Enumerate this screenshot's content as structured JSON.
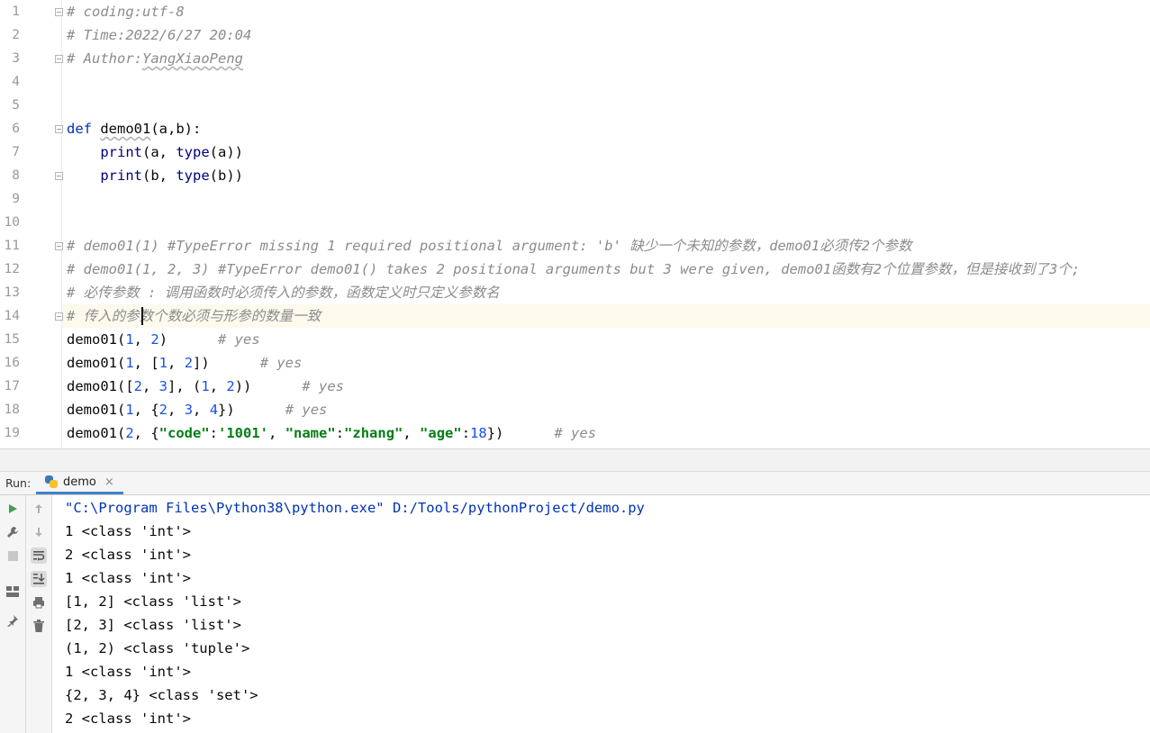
{
  "editor": {
    "line_numbers": [
      "1",
      "2",
      "3",
      "4",
      "5",
      "6",
      "7",
      "8",
      "9",
      "10",
      "11",
      "12",
      "13",
      "14",
      "15",
      "16",
      "17",
      "18",
      "19"
    ],
    "lines": [
      [
        {
          "t": "# coding:utf-8",
          "c": "cmt"
        }
      ],
      [
        {
          "t": "# Time:2022/6/27 20:04",
          "c": "cmt"
        }
      ],
      [
        {
          "t": "# Author:",
          "c": "cmt"
        },
        {
          "t": "YangXiaoPeng",
          "c": "cmt sq"
        }
      ],
      [],
      [],
      [
        {
          "t": "def",
          "c": "kw"
        },
        {
          "t": " "
        },
        {
          "t": "demo01",
          "c": "sq"
        },
        {
          "t": "(a,b):"
        }
      ],
      [
        {
          "t": "    "
        },
        {
          "t": "print",
          "c": "bi"
        },
        {
          "t": "(a, "
        },
        {
          "t": "type",
          "c": "bi"
        },
        {
          "t": "(a))"
        }
      ],
      [
        {
          "t": "    "
        },
        {
          "t": "print",
          "c": "bi"
        },
        {
          "t": "(b, "
        },
        {
          "t": "type",
          "c": "bi"
        },
        {
          "t": "(b))"
        }
      ],
      [],
      [],
      [
        {
          "t": "# demo01(1) #TypeError missing 1 required positional argument: 'b' 缺少一个未知的参数，demo01必须传2个参数",
          "c": "cmt"
        }
      ],
      [
        {
          "t": "# demo01(1, 2, 3) #TypeError demo01() takes 2 positional arguments but 3 were given, demo01函数有2个位置参数，但是接收到了3个;",
          "c": "cmt"
        }
      ],
      [
        {
          "t": "# 必传参数 : 调用函数时必须传入的参数，函数定义时只定义参数名",
          "c": "cmt"
        }
      ],
      [
        {
          "t": "# 传入的参数个数必须与形参的数量一致",
          "c": "cmt"
        }
      ],
      [
        {
          "t": "demo01("
        },
        {
          "t": "1",
          "c": "num"
        },
        {
          "t": ", "
        },
        {
          "t": "2",
          "c": "num"
        },
        {
          "t": ")      "
        },
        {
          "t": "# yes",
          "c": "cmt"
        }
      ],
      [
        {
          "t": "demo01("
        },
        {
          "t": "1",
          "c": "num"
        },
        {
          "t": ", ["
        },
        {
          "t": "1",
          "c": "num"
        },
        {
          "t": ", "
        },
        {
          "t": "2",
          "c": "num"
        },
        {
          "t": "])      "
        },
        {
          "t": "# yes",
          "c": "cmt"
        }
      ],
      [
        {
          "t": "demo01(["
        },
        {
          "t": "2",
          "c": "num"
        },
        {
          "t": ", "
        },
        {
          "t": "3",
          "c": "num"
        },
        {
          "t": "], ("
        },
        {
          "t": "1",
          "c": "num"
        },
        {
          "t": ", "
        },
        {
          "t": "2",
          "c": "num"
        },
        {
          "t": "))      "
        },
        {
          "t": "# yes",
          "c": "cmt"
        }
      ],
      [
        {
          "t": "demo01("
        },
        {
          "t": "1",
          "c": "num"
        },
        {
          "t": ", {"
        },
        {
          "t": "2",
          "c": "num"
        },
        {
          "t": ", "
        },
        {
          "t": "3",
          "c": "num"
        },
        {
          "t": ", "
        },
        {
          "t": "4",
          "c": "num"
        },
        {
          "t": "})      "
        },
        {
          "t": "# yes",
          "c": "cmt"
        }
      ],
      [
        {
          "t": "demo01("
        },
        {
          "t": "2",
          "c": "num"
        },
        {
          "t": ", {"
        },
        {
          "t": "\"code\"",
          "c": "str"
        },
        {
          "t": ":"
        },
        {
          "t": "'1001'",
          "c": "str"
        },
        {
          "t": ", "
        },
        {
          "t": "\"name\"",
          "c": "str"
        },
        {
          "t": ":"
        },
        {
          "t": "\"zhang\"",
          "c": "str"
        },
        {
          "t": ", "
        },
        {
          "t": "\"age\"",
          "c": "str"
        },
        {
          "t": ":"
        },
        {
          "t": "18",
          "c": "num"
        },
        {
          "t": "})      "
        },
        {
          "t": "# yes",
          "c": "cmt"
        }
      ]
    ]
  },
  "run_panel": {
    "label": "Run:",
    "tab_label": "demo",
    "tab_close": "×",
    "output": [
      "\"C:\\Program Files\\Python38\\python.exe\" D:/Tools/pythonProject/demo.py",
      "1 <class 'int'>",
      "2 <class 'int'>",
      "1 <class 'int'>",
      "[1, 2] <class 'list'>",
      "[2, 3] <class 'list'>",
      "(1, 2) <class 'tuple'>",
      "1 <class 'int'>",
      "{2, 3, 4} <class 'set'>",
      "2 <class 'int'>"
    ],
    "left_icons": [
      "play-icon",
      "wrench-icon",
      "stop-icon",
      "layout-icon",
      "pin-icon"
    ],
    "right_icons": [
      "arrow-up-icon",
      "arrow-down-icon",
      "soft-wrap-icon",
      "scroll-to-end-icon",
      "print-icon",
      "trash-icon"
    ]
  },
  "colors": {
    "keyword": "#0033b3",
    "builtin": "#000080",
    "number": "#1750eb",
    "string": "#067d17",
    "comment": "#8c8c8c",
    "current_line": "#fcfaed",
    "tab_underline": "#4083c9"
  }
}
